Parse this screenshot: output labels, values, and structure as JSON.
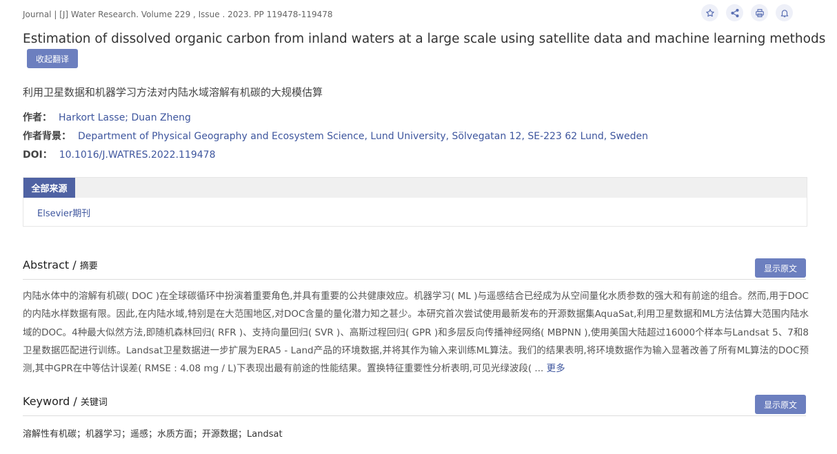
{
  "journal_line": "Journal | [J] Water Research. Volume 229 , Issue . 2023. PP 119478-119478",
  "actions": [
    {
      "name": "star-icon"
    },
    {
      "name": "share-icon"
    },
    {
      "name": "print-icon"
    },
    {
      "name": "bell-icon"
    }
  ],
  "title": "Estimation of dissolved organic carbon from inland waters at a large scale using satellite data and machine learning methods",
  "collapse_translation_label": "收起翻译",
  "cn_title": "利用卫星数据和机器学习方法对内陆水域溶解有机碳的大规模估算",
  "authors": {
    "label": "作者：",
    "value": "Harkort Lasse; Duan Zheng"
  },
  "affiliation": {
    "label": "作者背景：",
    "value": "Department of Physical Geography and Ecosystem Science, Lund University, Sölvegatan 12, SE-223 62 Lund, Sweden"
  },
  "doi": {
    "label": "DOI：",
    "value": "10.1016/J.WATRES.2022.119478"
  },
  "sources": {
    "tab_label": "全部来源",
    "items": [
      "Elsevier期刊"
    ]
  },
  "abstract": {
    "title_en": "Abstract /",
    "title_cn": "摘要",
    "show_original_label": "显示原文",
    "text": "内陆水体中的溶解有机碳( DOC )在全球碳循环中扮演着重要角色,并具有重要的公共健康效应。机器学习( ML )与遥感结合已经成为从空间量化水质参数的强大和有前途的组合。然而,用于DOC的内陆水样数据有限。因此,在内陆水域,特别是在大范围地区,对DOC含量的量化潜力知之甚少。本研究首次尝试使用最新发布的开源数据集AquaSat,利用卫星数据和ML方法估算大范围内陆水域的DOC。4种最大似然方法,即随机森林回归( RFR )、支持向量回归( SVR )、高斯过程回归( GPR )和多层反向传播神经网络( MBPNN ),使用美国大陆超过16000个样本与Landsat 5、7和8卫星数据匹配进行训练。Landsat卫星数据进一步扩展为ERA5 - Land产品的环境数据,并将其作为输入来训练ML算法。我们的结果表明,将环境数据作为输入显著改善了所有ML算法的DOC预测,其中GPR在中等估计误差( RMSE : 4.08 mg / L)下表现出最有前途的性能结果。置换特征重要性分析表明,可见光绿波段( ...",
    "more_label": "更多"
  },
  "keyword": {
    "title_en": "Keyword /",
    "title_cn": "关键词",
    "show_original_label": "显示原文",
    "text": "溶解性有机碳；机器学习；遥感；水质方面；开源数据；Landsat"
  }
}
